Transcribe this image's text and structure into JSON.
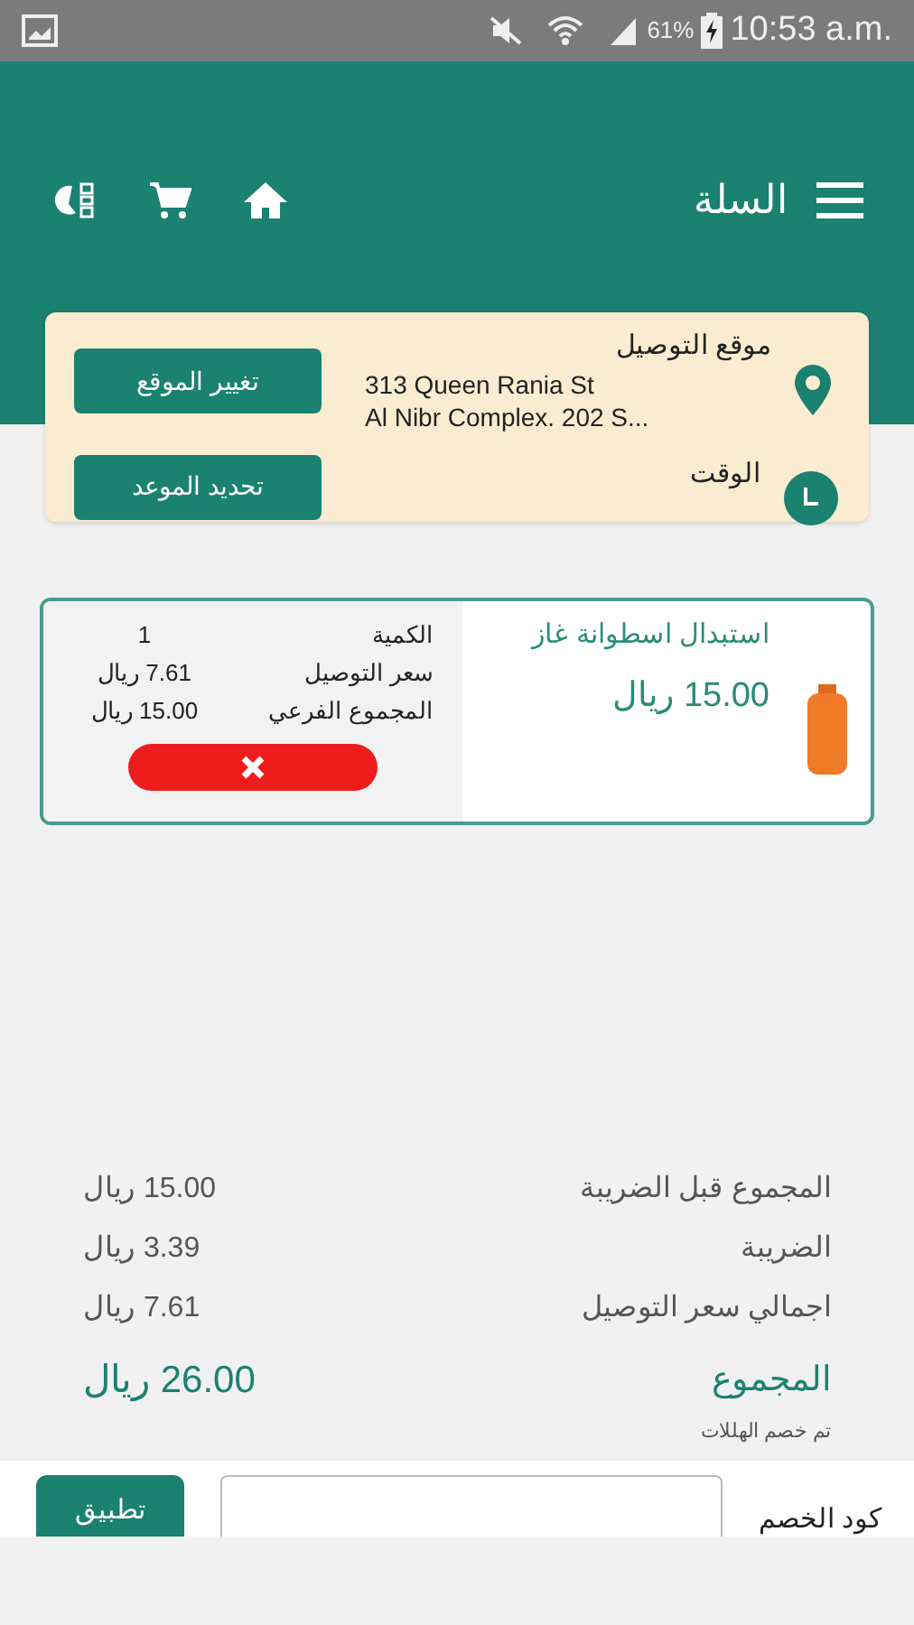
{
  "status_bar": {
    "battery": "61%",
    "time": "10:53 a.m."
  },
  "header": {
    "title": "السلة"
  },
  "delivery": {
    "location_label": "موقع التوصيل",
    "address_lines": [
      "313 Queen Rania St",
      "Al Nibr Complex. 202 S..."
    ],
    "change_location_button": "تغيير الموقع",
    "time_label": "الوقت",
    "schedule_button": "تحديد الموعد"
  },
  "cart_items": [
    {
      "name": "استبدال اسطوانة غاز",
      "price": "15.00 ريال",
      "details": [
        {
          "label": "الكمية",
          "value": "1"
        },
        {
          "label": "سعر التوصيل",
          "value": "7.61 ريال"
        },
        {
          "label": "المجموع الفرعي",
          "value": "15.00 ريال"
        }
      ]
    }
  ],
  "summary": {
    "rows": [
      {
        "label": "المجموع قبل الضريبة",
        "value": "15.00 ريال"
      },
      {
        "label": "الضريبة",
        "value": "3.39 ريال"
      },
      {
        "label": "اجمالي سعر التوصيل",
        "value": "7.61 ريال"
      }
    ],
    "total": {
      "label": "المجموع",
      "value": "26.00 ريال"
    },
    "note": "تم خصم الهللات"
  },
  "discount": {
    "label": "كود الخصم",
    "apply_button": "تطبيق"
  }
}
